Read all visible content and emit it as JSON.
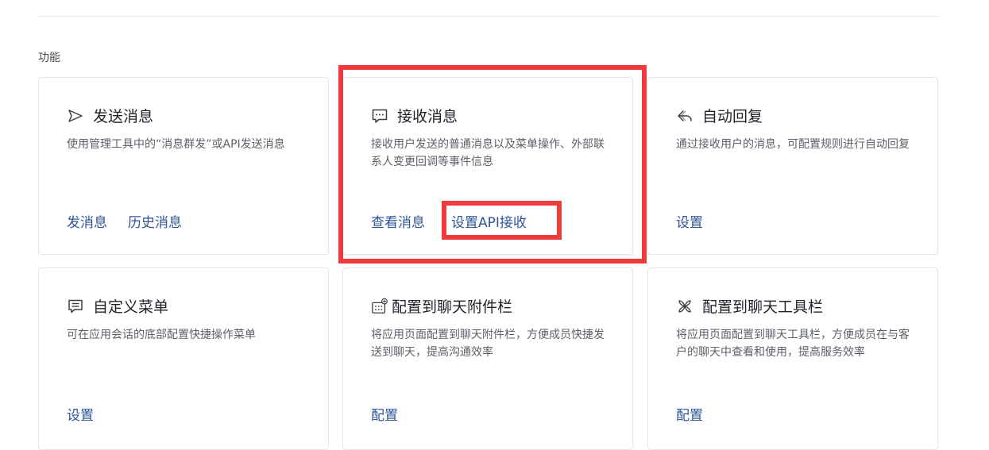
{
  "section": {
    "label": "功能"
  },
  "cards": [
    {
      "title": "发送消息",
      "icon": "send-icon",
      "desc": "使用管理工具中的“消息群发”或API发送消息",
      "links": [
        "发消息",
        "历史消息"
      ]
    },
    {
      "title": "接收消息",
      "icon": "chat-bubble-icon",
      "desc": "接收用户发送的普通消息以及菜单操作、外部联系人变更回调等事件信息",
      "links": [
        "查看消息",
        "设置API接收"
      ]
    },
    {
      "title": "自动回复",
      "icon": "reply-icon",
      "desc": "通过接收用户的消息，可配置规则进行自动回复",
      "links": [
        "设置"
      ]
    },
    {
      "title": "自定义菜单",
      "icon": "menu-icon",
      "desc": "可在应用会话的底部配置快捷操作菜单",
      "links": [
        "设置"
      ]
    },
    {
      "title": "配置到聊天附件栏",
      "icon": "attachment-bar-icon",
      "desc": "将应用页面配置到聊天附件栏，方便成员快捷发送到聊天，提高沟通效率",
      "links": [
        "配置"
      ]
    },
    {
      "title": "配置到聊天工具栏",
      "icon": "toolbar-icon",
      "desc": "将应用页面配置到聊天工具栏，方便成员在与客户的聊天中查看和使用，提高服务效率",
      "links": [
        "配置"
      ]
    }
  ],
  "colors": {
    "link": "#2d5597",
    "highlight": "#ef3b3b",
    "title": "#1f2329",
    "desc": "#5c6168"
  }
}
